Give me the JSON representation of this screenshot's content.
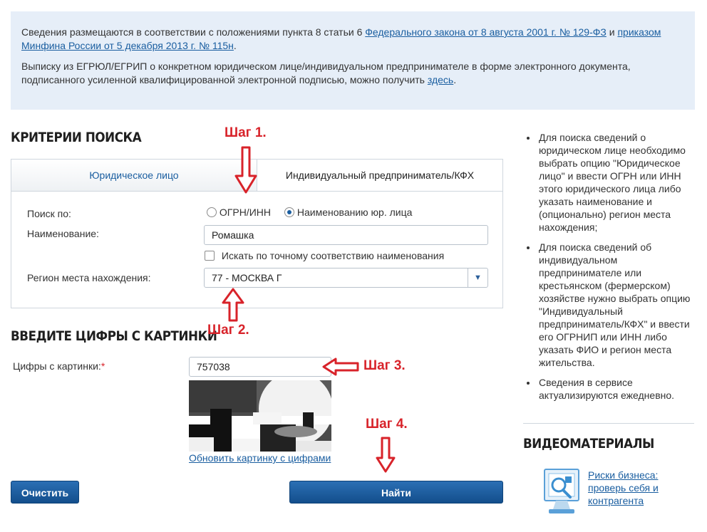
{
  "info": {
    "p1_prefix": "Сведения размещаются в соответствии с положениями пункта 8 статьи 6 ",
    "p1_link1": "Федерального закона от 8 августа 2001 г. № 129-ФЗ",
    "p1_and": " и ",
    "p1_link2": "приказом Минфина России от 5 декабря 2013 г. № 115н",
    "p1_suffix": ".",
    "p2_prefix": "Выписку из ЕГРЮЛ/ЕГРИП о конкретном юридическом лице/индивидуальном предпринимателе в форме электронного документа, подписанного усиленной квалифицированной электронной подписью, можно получить ",
    "p2_link": "здесь",
    "p2_suffix": "."
  },
  "search": {
    "heading": "КРИТЕРИИ ПОИСКА",
    "tabs": [
      "Юридическое лицо",
      "Индивидуальный предприниматель/КФХ"
    ],
    "search_by_label": "Поиск по:",
    "radio_options": [
      "ОГРН/ИНН",
      "Наименованию юр. лица"
    ],
    "name_label": "Наименование:",
    "name_value": "Ромашка",
    "exact_match_label": "Искать по точному соответствию наименования",
    "region_label": "Регион места нахождения:",
    "region_value": "77 - МОСКВА Г"
  },
  "captcha": {
    "heading": "ВВЕДИТЕ ЦИФРЫ С КАРТИНКИ",
    "label": "Цифры с картинки:",
    "required_mark": "*",
    "value": "757038",
    "refresh_link": "Обновить картинку с цифрами"
  },
  "buttons": {
    "clear": "Очистить",
    "find": "Найти"
  },
  "steps": [
    "Шаг 1.",
    "Шаг 2.",
    "Шаг 3.",
    "Шаг 4."
  ],
  "sidebar": {
    "items": [
      "Для поиска сведений о юридическом лице необходимо выбрать опцию \"Юридическое лицо\" и ввести ОГРН или ИНН этого юридического лица либо указать наименование и (опционально) регион места нахождения;",
      "Для поиска сведений об индивидуальном предпринимателе или крестьянском (фермерском) хозяйстве нужно выбрать опцию \"Индивидуальный предприниматель/КФХ\" и ввести его ОГРНИП или ИНН либо указать ФИО и регион места жительства.",
      "Сведения в сервисе актуализируются ежедневно."
    ],
    "video_heading": "ВИДЕОМАТЕРИАЛЫ",
    "video_link": "Риски бизнеса: проверь себя и контрагента"
  },
  "colors": {
    "accent": "#1a5ea0",
    "step": "#d8232a",
    "info_bg": "#e6eef8"
  }
}
